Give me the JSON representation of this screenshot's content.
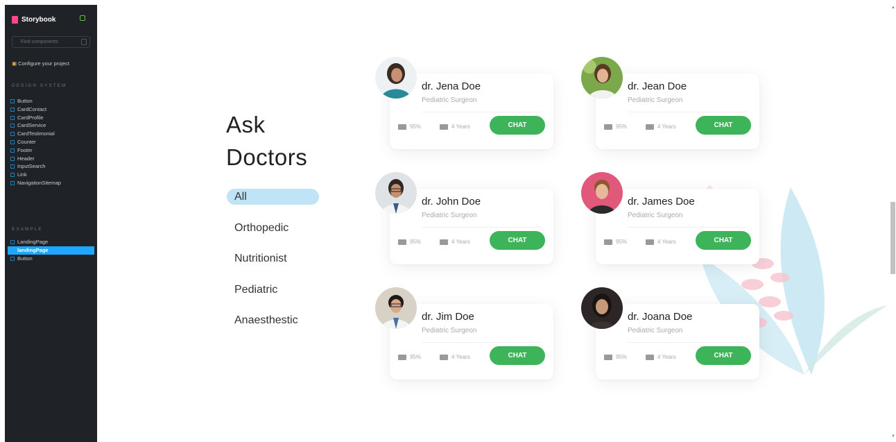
{
  "sidebar": {
    "brand": "Storybook",
    "search_placeholder": "Find components",
    "configure": "Configure your project",
    "group1": "DESIGN SYSTEM",
    "group1_items": [
      "Button",
      "CardContact",
      "CardProfile",
      "CardService",
      "CardTestimonial",
      "Counter",
      "Footer",
      "Header",
      "InputSearch",
      "Link",
      "NavigationSitemap"
    ],
    "group2": "EXAMPLE",
    "group2_items": [
      "LandingPage",
      "landingPage",
      "Button"
    ],
    "selected": "landingPage"
  },
  "page": {
    "title_line1": "Ask",
    "title_line2": "Doctors",
    "categories": [
      "All",
      "Orthopedic",
      "Nutritionist",
      "Pediatric",
      "Anaesthestic"
    ],
    "active_category": "All"
  },
  "doctors": [
    {
      "name": "dr. Jena Doe",
      "specialty": "Pediatric Surgeon",
      "rating": "95%",
      "experience": "4 Years",
      "cta": "CHAT",
      "avatar_color": "#2a8a99"
    },
    {
      "name": "dr. Jean Doe",
      "specialty": "Pediatric Surgeon",
      "rating": "95%",
      "experience": "4 Years",
      "cta": "CHAT",
      "avatar_color": "#7ba84a"
    },
    {
      "name": "dr. John Doe",
      "specialty": "Pediatric Surgeon",
      "rating": "95%",
      "experience": "4 Years",
      "cta": "CHAT",
      "avatar_color": "#4a5560"
    },
    {
      "name": "dr. James Doe",
      "specialty": "Pediatric Surgeon",
      "rating": "95%",
      "experience": "4 Years",
      "cta": "CHAT",
      "avatar_color": "#e0587a"
    },
    {
      "name": "dr. Jim Doe",
      "specialty": "Pediatric Surgeon",
      "rating": "95%",
      "experience": "4 Years",
      "cta": "CHAT",
      "avatar_color": "#b9b2a4"
    },
    {
      "name": "dr. Joana Doe",
      "specialty": "Pediatric Surgeon",
      "rating": "95%",
      "experience": "4 Years",
      "cta": "CHAT",
      "avatar_color": "#2c2726"
    }
  ],
  "colors": {
    "accent_green": "#3db35a",
    "active_pill": "#bfe3f7",
    "sidebar_bg": "#1f2227",
    "selection": "#1ea7fd"
  },
  "icons": {
    "rating": "thumbs-up-icon",
    "experience": "briefcase-icon"
  }
}
